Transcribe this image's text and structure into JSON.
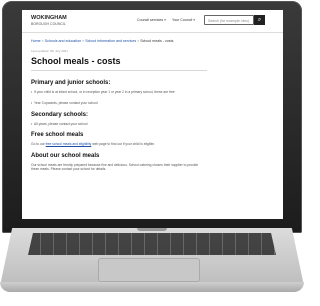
{
  "header": {
    "logo_line1": "WOKINGHAM",
    "logo_line2": "BOROUGH COUNCIL",
    "nav": [
      "Council services",
      "Your Council"
    ],
    "search_placeholder": "Search (for example: bins)",
    "search_icon": "search-icon"
  },
  "breadcrumb": {
    "items": [
      "Home",
      "Schools and education",
      "School information and services"
    ],
    "current": "School meals - costs",
    "separator": ">"
  },
  "page": {
    "updated": "Last updated: 6th July 2021",
    "title": "School meals - costs"
  },
  "sections": [
    {
      "heading": "Primary and junior schools:",
      "bullets": [
        "If your child is at infant school, or in reception year 1 or year 2 in a primary school, these are free",
        "Year 3 upwards, please contact your school"
      ]
    },
    {
      "heading": "Secondary schools:",
      "bullets": [
        "All years, please contact your school"
      ]
    },
    {
      "heading": "Free school meals",
      "para_prefix": "Go to our",
      "link": "free school meals and eligibility",
      "para_suffix": "web page to find out if your child is eligible."
    },
    {
      "heading": "About our school meals",
      "para": "Our school meals are freshly prepared because fine and delicious. School catering chosen their supplier to provide these meals. Please contact your school for details."
    }
  ],
  "colors": {
    "link": "#1d4fa8",
    "bezel": "#1c1c1c",
    "search_button": "#222222"
  }
}
